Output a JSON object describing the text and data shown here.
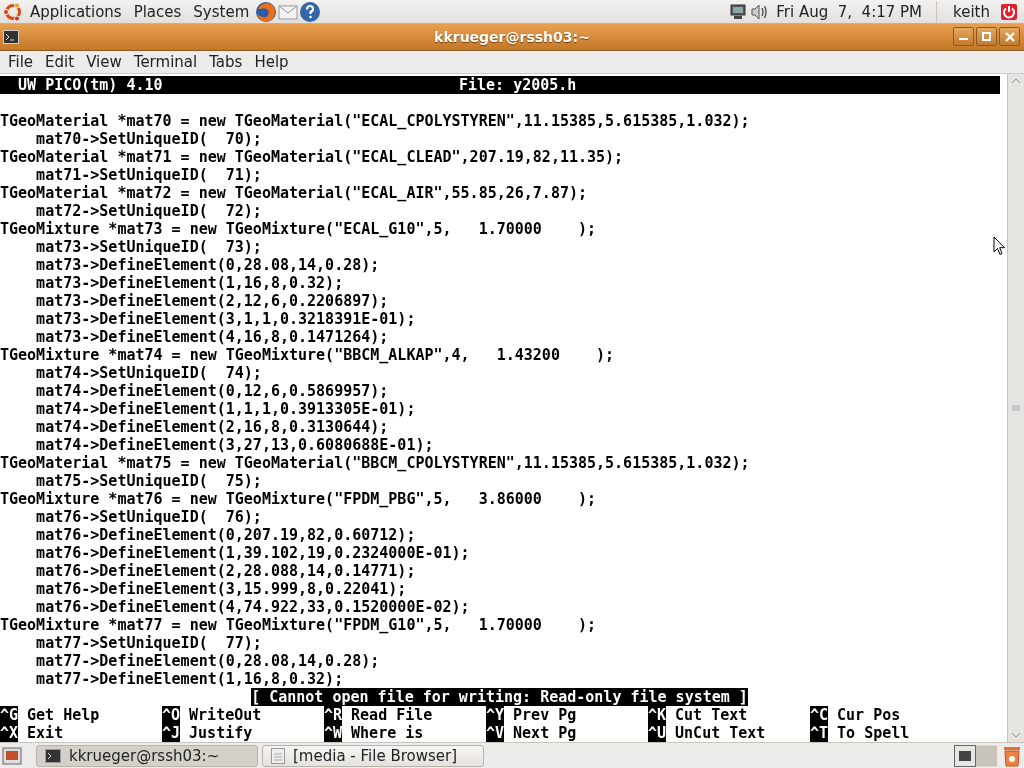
{
  "top_panel": {
    "menus": [
      "Applications",
      "Places",
      "System"
    ],
    "clock": "Fri Aug  7,  4:17 PM",
    "user": "keith"
  },
  "window": {
    "title": "kkrueger@rssh03:~"
  },
  "menu_bar": [
    "File",
    "Edit",
    "View",
    "Terminal",
    "Tabs",
    "Help"
  ],
  "editor": {
    "program": "  UW PICO(tm) 4.10",
    "file": "File: y2005.h",
    "lines": [
      "TGeoMaterial *mat70 = new TGeoMaterial(\"ECAL_CPOLYSTYREN\",11.15385,5.615385,1.032);",
      "    mat70->SetUniqueID(  70);",
      "TGeoMaterial *mat71 = new TGeoMaterial(\"ECAL_CLEAD\",207.19,82,11.35);",
      "    mat71->SetUniqueID(  71);",
      "TGeoMaterial *mat72 = new TGeoMaterial(\"ECAL_AIR\",55.85,26,7.87);",
      "    mat72->SetUniqueID(  72);",
      "TGeoMixture *mat73 = new TGeoMixture(\"ECAL_G10\",5,   1.70000    );",
      "    mat73->SetUniqueID(  73);",
      "    mat73->DefineElement(0,28.08,14,0.28);",
      "    mat73->DefineElement(1,16,8,0.32);",
      "    mat73->DefineElement(2,12,6,0.2206897);",
      "    mat73->DefineElement(3,1,1,0.3218391E-01);",
      "    mat73->DefineElement(4,16,8,0.1471264);",
      "TGeoMixture *mat74 = new TGeoMixture(\"BBCM_ALKAP\",4,   1.43200    );",
      "    mat74->SetUniqueID(  74);",
      "    mat74->DefineElement(0,12,6,0.5869957);",
      "    mat74->DefineElement(1,1,1,0.3913305E-01);",
      "    mat74->DefineElement(2,16,8,0.3130644);",
      "    mat74->DefineElement(3,27,13,0.6080688E-01);",
      "TGeoMaterial *mat75 = new TGeoMaterial(\"BBCM_CPOLYSTYREN\",11.15385,5.615385,1.032);",
      "    mat75->SetUniqueID(  75);",
      "TGeoMixture *mat76 = new TGeoMixture(\"FPDM_PBG\",5,   3.86000    );",
      "    mat76->SetUniqueID(  76);",
      "    mat76->DefineElement(0,207.19,82,0.60712);",
      "    mat76->DefineElement(1,39.102,19,0.2324000E-01);",
      "    mat76->DefineElement(2,28.088,14,0.14771);",
      "    mat76->DefineElement(3,15.999,8,0.22041);",
      "    mat76->DefineElement(4,74.922,33,0.1520000E-02);",
      "TGeoMixture *mat77 = new TGeoMixture(\"FPDM_G10\",5,   1.70000    );",
      "    mat77->SetUniqueID(  77);",
      "    mat77->DefineElement(0,28.08,14,0.28);",
      "    mat77->DefineElement(1,16,8,0.32);"
    ],
    "status": "[ Cannot open file for writing: Read-only file system ]",
    "shortcuts": [
      {
        "key": "^G",
        "label": "Get Help"
      },
      {
        "key": "^O",
        "label": "WriteOut"
      },
      {
        "key": "^R",
        "label": "Read File"
      },
      {
        "key": "^Y",
        "label": "Prev Pg"
      },
      {
        "key": "^K",
        "label": "Cut Text"
      },
      {
        "key": "^C",
        "label": "Cur Pos"
      },
      {
        "key": "^X",
        "label": "Exit"
      },
      {
        "key": "^J",
        "label": "Justify"
      },
      {
        "key": "^W",
        "label": "Where is"
      },
      {
        "key": "^V",
        "label": "Next Pg"
      },
      {
        "key": "^U",
        "label": "UnCut Text"
      },
      {
        "key": "^T",
        "label": "To Spell"
      }
    ]
  },
  "taskbar": {
    "tasks": [
      {
        "kind": "terminal",
        "label": "kkrueger@rssh03:~",
        "selected": true
      },
      {
        "kind": "browser",
        "label": "[media - File Browser]",
        "selected": false
      }
    ]
  }
}
